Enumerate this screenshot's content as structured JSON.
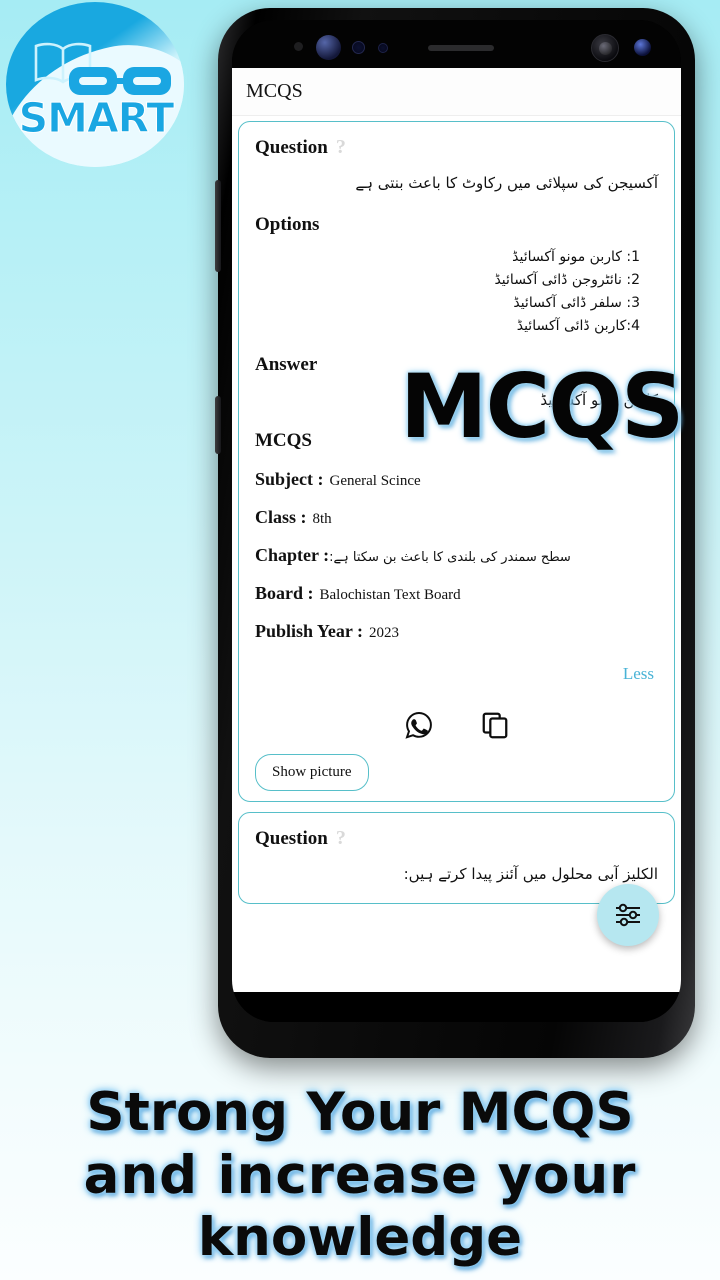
{
  "brand": {
    "logo_text": "SMART",
    "logo_icon": "open-book-icon"
  },
  "phone": {
    "statusbar_icons": [
      "proximity-sensor",
      "front-camera",
      "iris-sensor",
      "light-sensor",
      "earpiece-speaker",
      "secondary-camera",
      "notification-led"
    ]
  },
  "app": {
    "title": "MCQS"
  },
  "watermark": "MCQS",
  "card1": {
    "question_label": "Question",
    "question_marker": "?",
    "question_text": "آکسیجن کی سپلائی میں رکاوٹ کا باعث بنتی ہے",
    "options_label": "Options",
    "options": [
      "1: کاربن مونو آکسائیڈ",
      "2: نائٹروجن ڈائی آکسائیڈ",
      "3: سلفر ڈائی آکسائیڈ",
      "4:کاربن ڈائی آکسائیڈ"
    ],
    "answer_label": "Answer",
    "answer_text": "کاربن مونو آکسائیڈ",
    "section_label": "MCQS",
    "meta": [
      {
        "label": "Subject :",
        "value": "General Scince",
        "rtl": false
      },
      {
        "label": "Class :",
        "value": "8th",
        "rtl": false
      },
      {
        "label": "Chapter :",
        "value": "سطح سمندر کی بلندی کا باعث بن سکتا ہے:",
        "rtl": true
      },
      {
        "label": "Board :",
        "value": "Balochistan Text Board",
        "rtl": false
      },
      {
        "label": "Publish Year :",
        "value": "2023",
        "rtl": false
      }
    ],
    "less_label": "Less",
    "share_icon": "whatsapp-icon",
    "copy_icon": "copy-icon",
    "show_picture_label": "Show picture"
  },
  "card2": {
    "question_label": "Question",
    "question_marker": "?",
    "question_text": "الکلیز آبی محلول میں آئنز پیدا کرتے ہیں:"
  },
  "fab": {
    "icon": "filter-sliders-icon"
  },
  "tagline": {
    "line1": "Strong  Your  MCQS",
    "line2": "and  increase  your",
    "line3": "knowledge"
  },
  "colors": {
    "background_top": "#a6ecf4",
    "background_bottom": "#fbfeff",
    "card_border": "#57bfc9",
    "accent_link": "#49b3d6",
    "fab_bg": "#b6e7f0",
    "logo_blue": "#1aa6e2"
  }
}
